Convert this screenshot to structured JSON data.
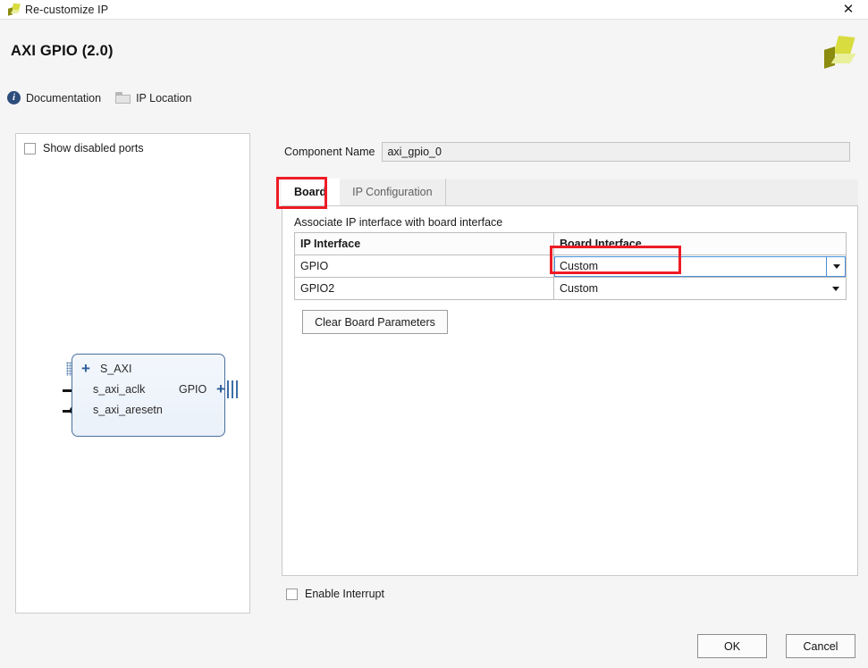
{
  "window": {
    "title": "Re-customize IP",
    "close_label": "✕",
    "app_icon": "xilinx-pinwheel-icon"
  },
  "header": {
    "ip_title": "AXI GPIO (2.0)",
    "logo": "xilinx-logo",
    "links": [
      {
        "label": "Documentation",
        "icon": "info-icon"
      },
      {
        "label": "IP Location",
        "icon": "folder-icon"
      }
    ]
  },
  "preview": {
    "show_disabled_ports": {
      "label": "Show disabled ports",
      "checked": false
    },
    "block": {
      "left_ports": [
        {
          "name": "S_AXI",
          "connector": "bus-dotted",
          "expander": "+"
        },
        {
          "name": "s_axi_aclk",
          "connector": "line"
        },
        {
          "name": "s_axi_aresetn",
          "connector": "line-inverted"
        }
      ],
      "right_ports": [
        {
          "name": "GPIO",
          "connector": "bus-striped",
          "expander": "+"
        }
      ]
    }
  },
  "main": {
    "component_name": {
      "label": "Component Name",
      "value": "axi_gpio_0"
    },
    "tabs": [
      {
        "label": "Board",
        "active": true
      },
      {
        "label": "IP Configuration",
        "active": false
      }
    ],
    "board_tab": {
      "associate_text": "Associate IP interface with board interface",
      "table": {
        "columns": [
          "IP Interface",
          "Board Interface"
        ],
        "rows": [
          {
            "ip_interface": "GPIO",
            "board_interface": "Custom",
            "active": true
          },
          {
            "ip_interface": "GPIO2",
            "board_interface": "Custom",
            "active": false
          }
        ]
      },
      "clear_button": "Clear Board Parameters"
    },
    "enable_interrupt": {
      "label": "Enable Interrupt",
      "checked": false
    }
  },
  "footer": {
    "ok_label": "OK",
    "cancel_label": "Cancel"
  },
  "annotations": {
    "accent_color": "#ee1c25",
    "highlighted": [
      "board-tab",
      "gpio-board-interface-combo"
    ]
  }
}
